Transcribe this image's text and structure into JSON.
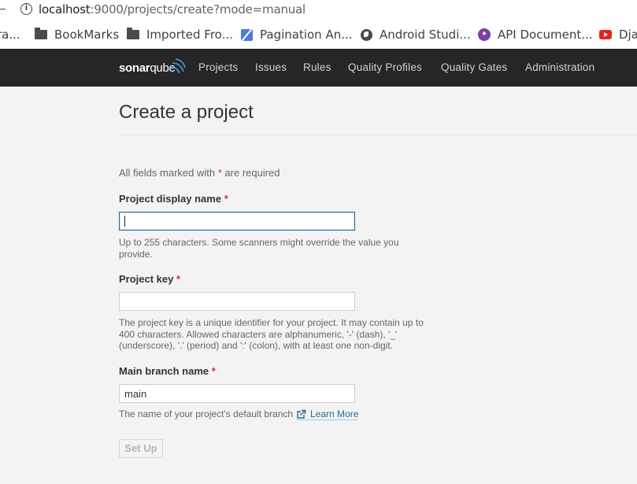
{
  "browser": {
    "url_host": "localhost",
    "url_rest": ":9000/projects/create?mode=manual",
    "bookmarks": [
      {
        "label": "ra...",
        "icon": "none"
      },
      {
        "label": "BookMarks",
        "icon": "folder-icon"
      },
      {
        "label": "Imported Fro...",
        "icon": "folder-icon"
      },
      {
        "label": "Pagination An...",
        "icon": "pagination-icon"
      },
      {
        "label": "Android Studi...",
        "icon": "globe-icon"
      },
      {
        "label": "API Document...",
        "icon": "api-icon"
      },
      {
        "label": "Dja",
        "icon": "youtube-icon"
      }
    ]
  },
  "nav": {
    "logo_bold": "sonar",
    "logo_regular": "qube",
    "items": [
      "Projects",
      "Issues",
      "Rules",
      "Quality Profiles",
      "Quality Gates",
      "Administration"
    ]
  },
  "page": {
    "title": "Create a project",
    "required_note_prefix": "All fields marked with ",
    "required_note_star": "*",
    "required_note_suffix": " are required"
  },
  "form": {
    "display_name": {
      "label": "Project display name",
      "star": "*",
      "value": "",
      "help": "Up to 255 characters. Some scanners might override the value you provide."
    },
    "project_key": {
      "label": "Project key",
      "star": "*",
      "value": "",
      "help": "The project key is a unique identifier for your project. It may contain up to 400 characters. Allowed characters are alphanumeric, '-' (dash), '_' (underscore), '.' (period) and ':' (colon), with at least one non-digit."
    },
    "main_branch": {
      "label": "Main branch name",
      "star": "*",
      "value": "main",
      "help": "The name of your project's default branch",
      "learn_more": "Learn More"
    },
    "submit_label": "Set Up"
  },
  "colors": {
    "nav_bg": "#262626",
    "link": "#236a97",
    "required": "#d02f3a",
    "logo_accent": "#4b9fd5"
  }
}
